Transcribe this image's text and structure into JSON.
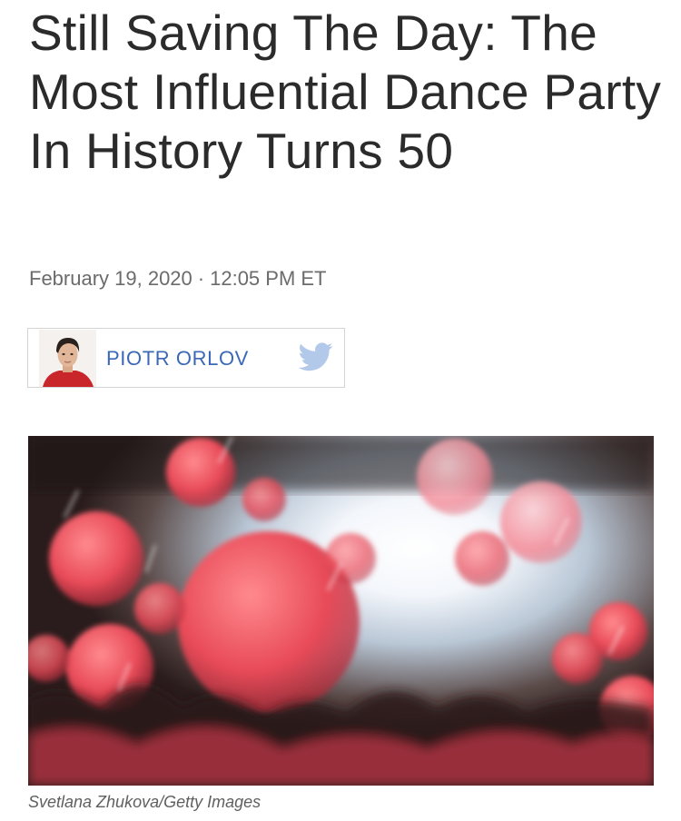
{
  "article": {
    "headline": "Still Saving The Day: The Most Influential Dance Party In History Turns 50",
    "date": "February 19, 2020",
    "separator": "·",
    "time": "12:05 PM ET"
  },
  "author": {
    "name": "PIOTR ORLOV",
    "avatar_icon": "author-avatar",
    "social_icon": "twitter-bird-icon",
    "name_color": "#3a68b6",
    "twitter_color": "#b3c9ea"
  },
  "image": {
    "credit": "Svetlana Zhukova/Getty Images"
  }
}
